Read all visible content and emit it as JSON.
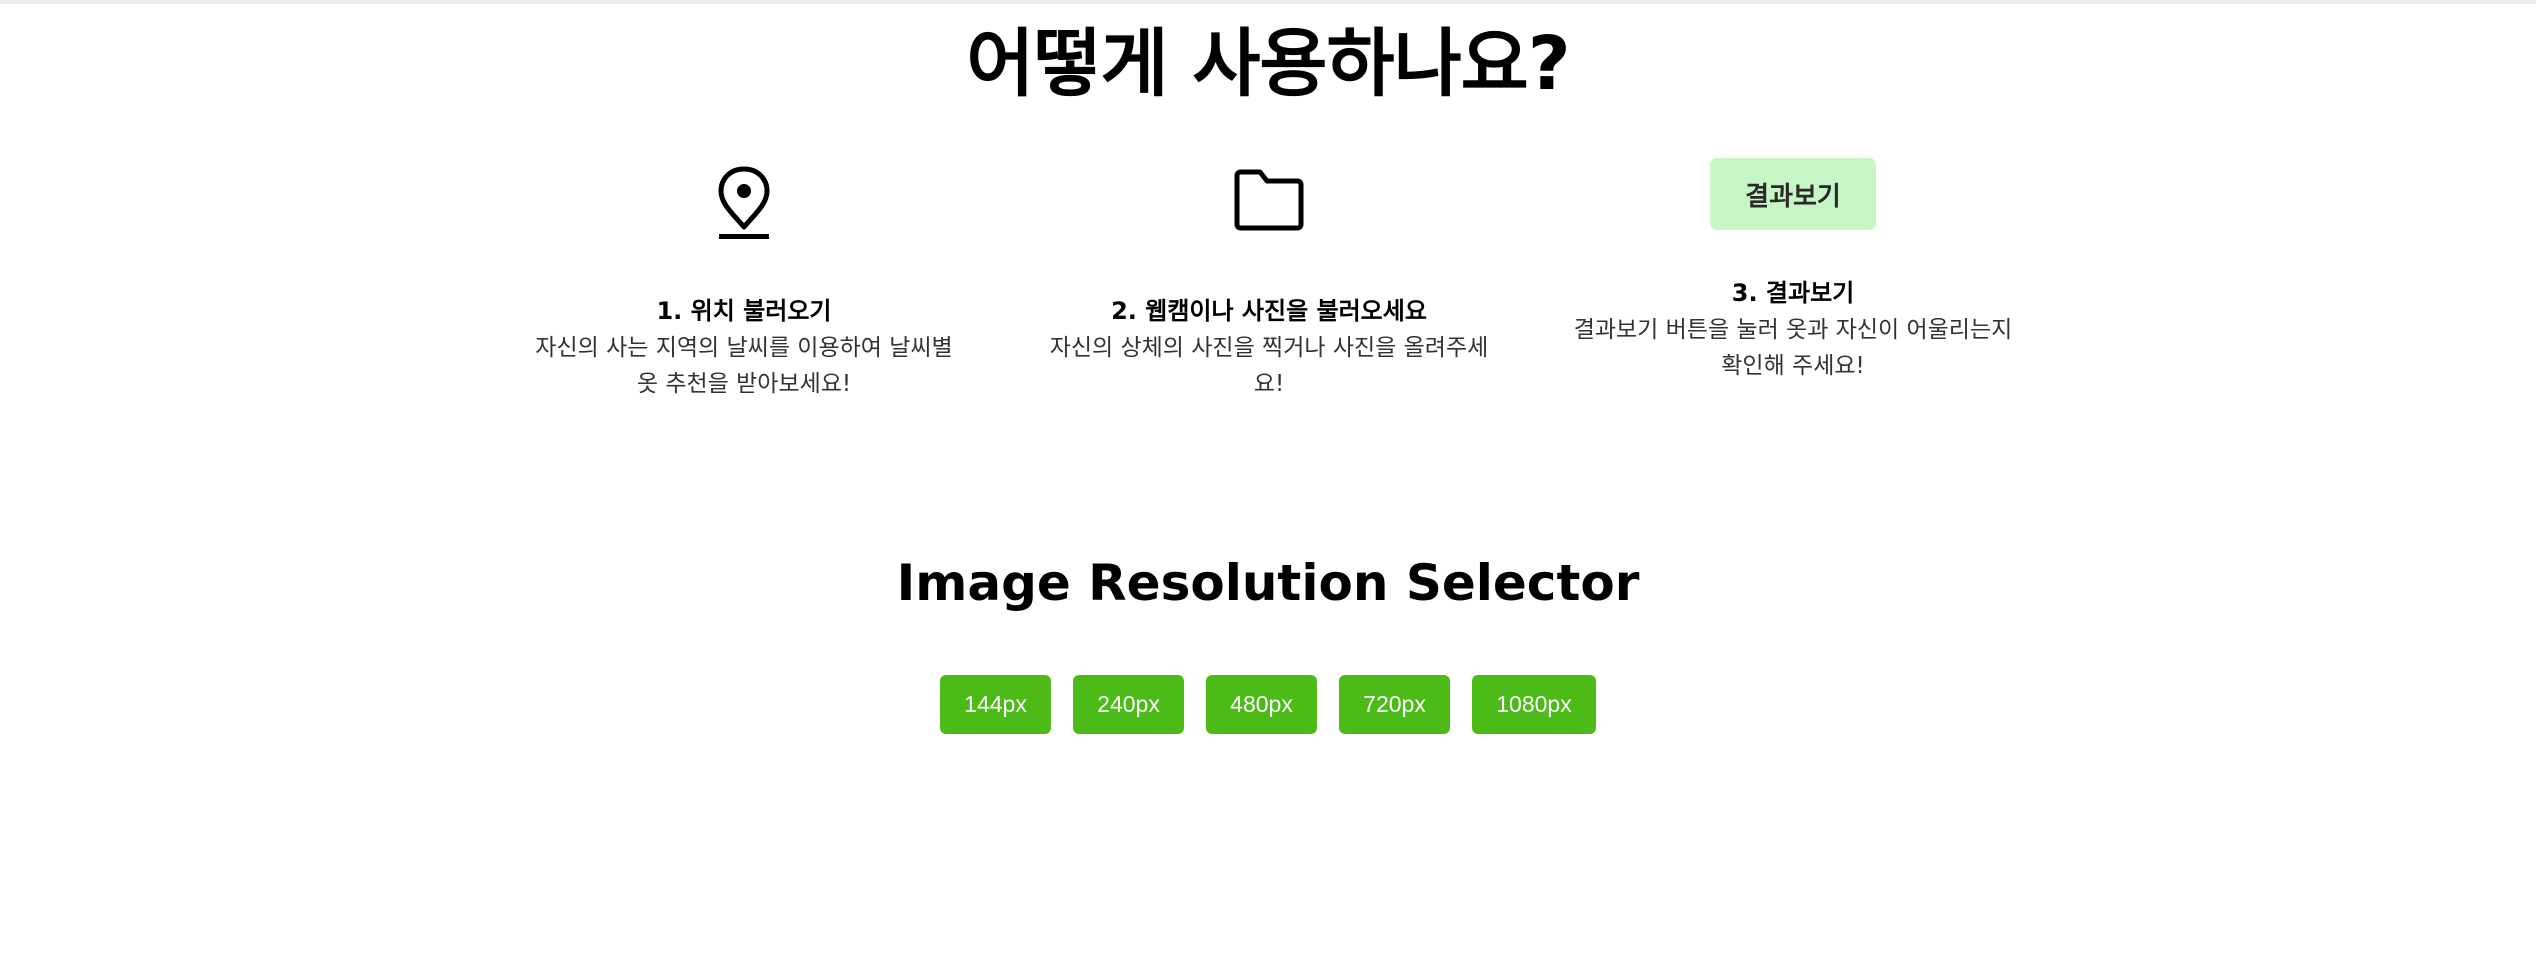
{
  "how_to": {
    "title": "어떻게 사용하나요?",
    "steps": [
      {
        "icon": "location-pin-icon",
        "title": "1. 위치 불러오기",
        "description": "자신의 사는 지역의 날씨를 이용하여 날씨별 옷 추천을 받아보세요!"
      },
      {
        "icon": "folder-icon",
        "title": "2. 웹캠이나 사진을 불러오세요",
        "description": "자신의 상체의 사진을 찍거나 사진을 올려주세요!"
      },
      {
        "button_label": "결과보기",
        "title": "3. 결과보기",
        "description": "결과보기 버튼을 눌러 옷과 자신이 어울리는지 확인해 주세요!"
      }
    ]
  },
  "resolution": {
    "title": "Image Resolution Selector",
    "options": [
      "144px",
      "240px",
      "480px",
      "720px",
      "1080px"
    ]
  },
  "colors": {
    "resolution_button": "#4cbb17",
    "result_button": "#c6f6c6"
  }
}
